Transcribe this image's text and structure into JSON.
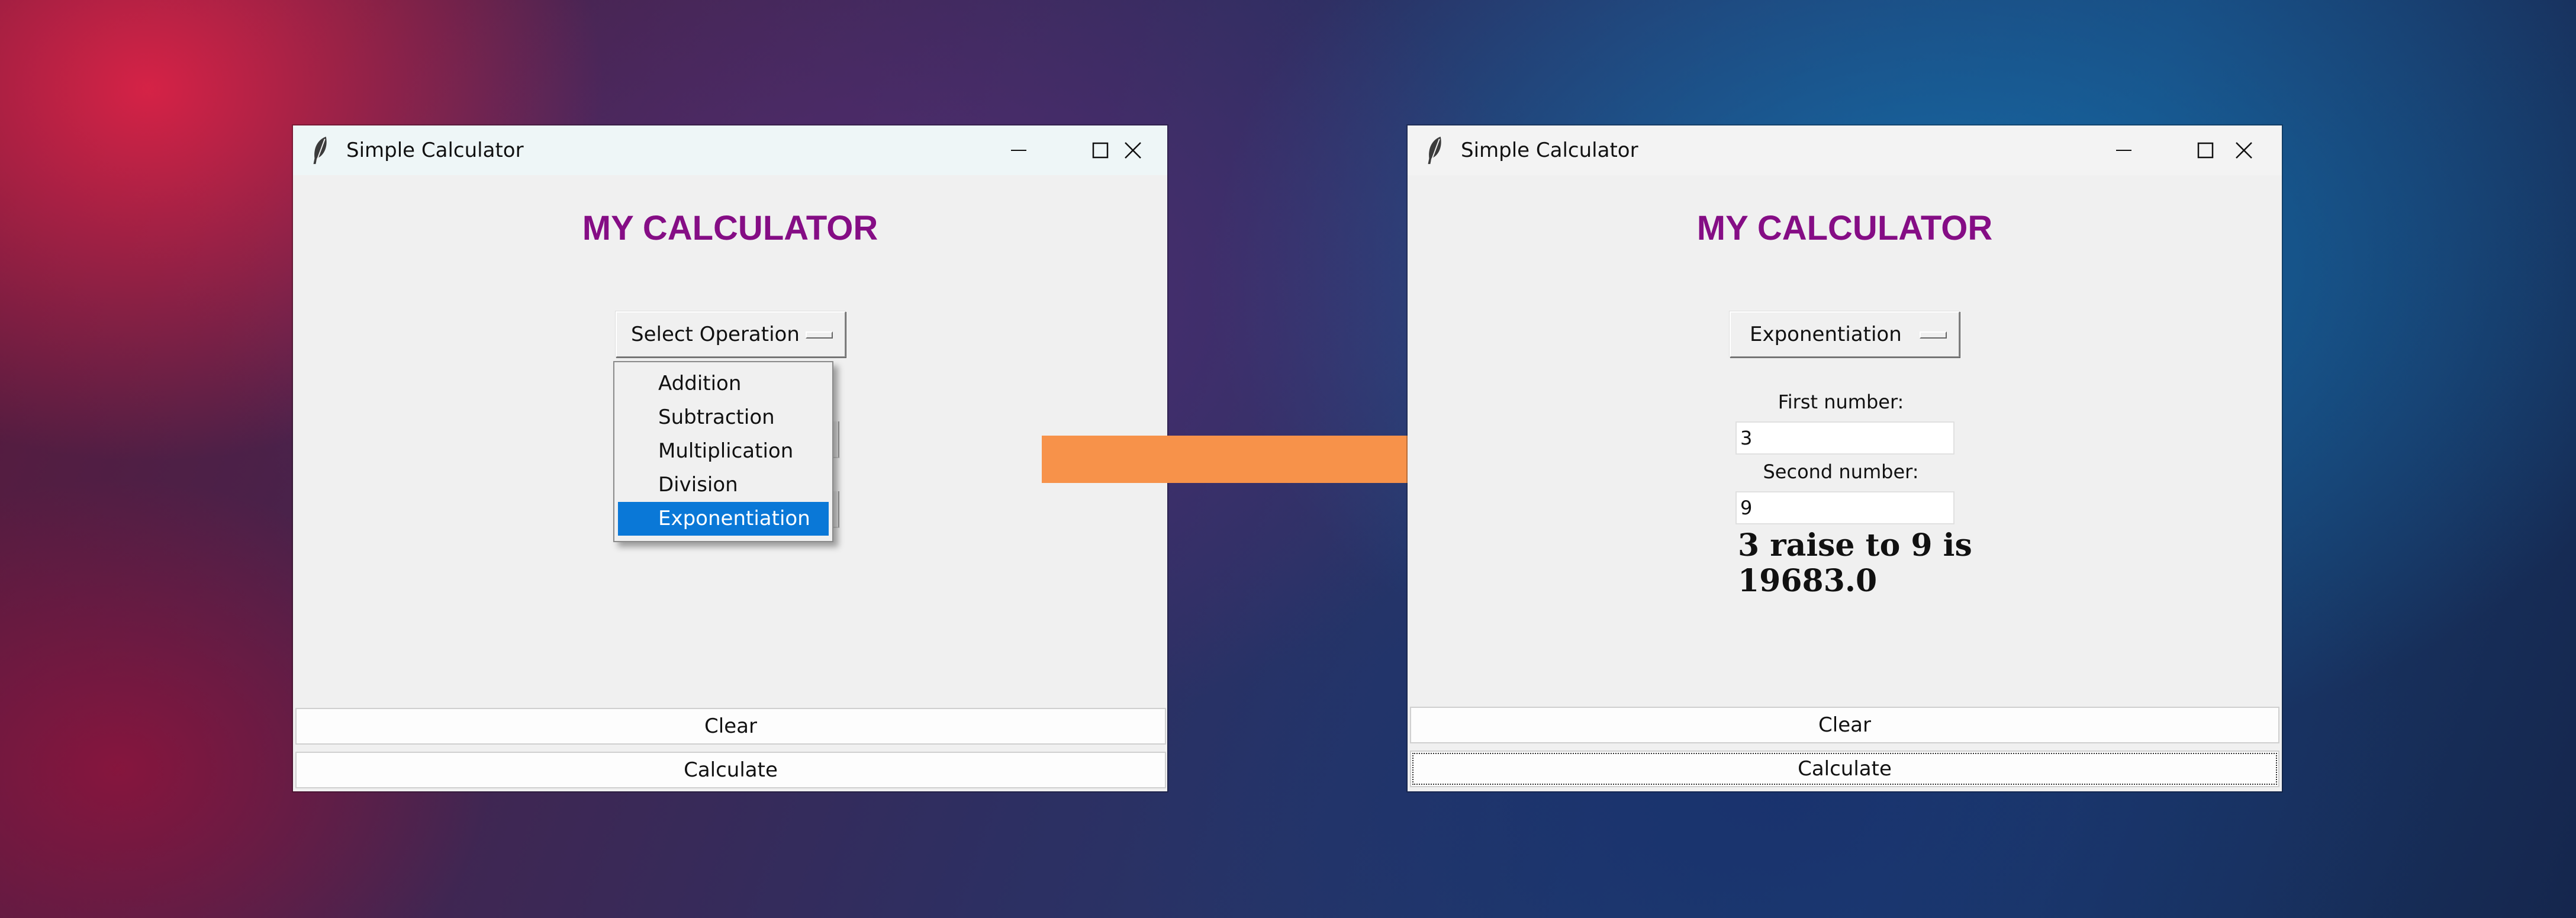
{
  "left_window": {
    "title": "Simple Calculator",
    "heading": "MY CALCULATOR",
    "operation_menu": {
      "selected": "Select Operation"
    },
    "dropdown_items": [
      {
        "label": "Addition"
      },
      {
        "label": "Subtraction"
      },
      {
        "label": "Multiplication"
      },
      {
        "label": "Division"
      },
      {
        "label": "Exponentiation",
        "highlighted": true
      }
    ],
    "buttons": {
      "clear": "Clear",
      "calculate": "Calculate"
    }
  },
  "right_window": {
    "title": "Simple Calculator",
    "heading": "MY CALCULATOR",
    "operation_menu": {
      "selected": "Exponentiation"
    },
    "first_label": "First number:",
    "first_value": "3",
    "second_label": "Second number:",
    "second_value": "9",
    "result_line1": "3 raise to 9 is",
    "result_line2": "19683.0",
    "buttons": {
      "clear": "Clear",
      "calculate": "Calculate"
    }
  },
  "colors": {
    "heading": "#850d85",
    "selection": "#0a78d7",
    "arrow": "#f7924a",
    "window_bg": "#f0f0f0"
  },
  "icons": [
    "feather-icon",
    "minimize-icon",
    "maximize-icon",
    "close-icon",
    "menu-indicator-icon",
    "right-arrow-icon"
  ]
}
